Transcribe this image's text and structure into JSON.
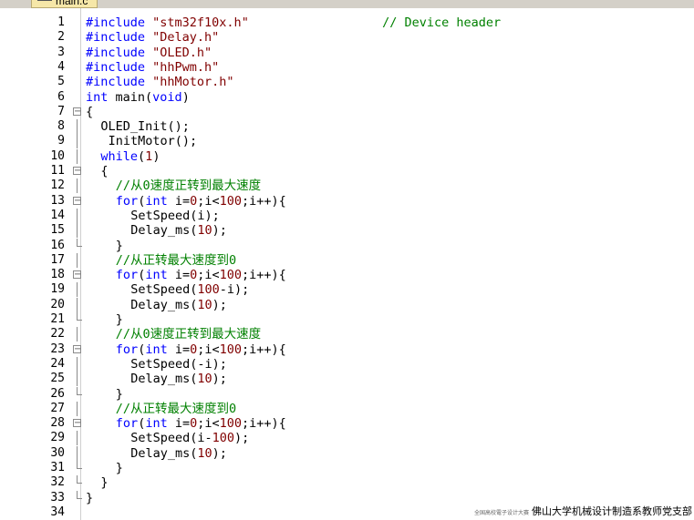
{
  "tab": {
    "title": "main.c"
  },
  "lines": [
    {
      "n": "1",
      "indent": 0,
      "fold": "",
      "tokens": [
        [
          "kw",
          "#include "
        ],
        [
          "str",
          "\"stm32f10x.h\""
        ],
        [
          "p",
          "                  "
        ],
        [
          "cm",
          "// Device header"
        ]
      ]
    },
    {
      "n": "2",
      "indent": 0,
      "fold": "",
      "tokens": [
        [
          "kw",
          "#include "
        ],
        [
          "str",
          "\"Delay.h\""
        ]
      ]
    },
    {
      "n": "3",
      "indent": 0,
      "fold": "",
      "tokens": [
        [
          "kw",
          "#include "
        ],
        [
          "str",
          "\"OLED.h\""
        ]
      ]
    },
    {
      "n": "4",
      "indent": 0,
      "fold": "",
      "tokens": [
        [
          "kw",
          "#include "
        ],
        [
          "str",
          "\"hhPwm.h\""
        ]
      ]
    },
    {
      "n": "5",
      "indent": 0,
      "fold": "",
      "tokens": [
        [
          "kw",
          "#include "
        ],
        [
          "str",
          "\"hhMotor.h\""
        ]
      ]
    },
    {
      "n": "6",
      "indent": 0,
      "fold": "",
      "tokens": [
        [
          "kw",
          "int"
        ],
        [
          "p",
          " main("
        ],
        [
          "kw",
          "void"
        ],
        [
          "p",
          ")"
        ]
      ]
    },
    {
      "n": "7",
      "indent": 0,
      "fold": "open",
      "tokens": [
        [
          "p",
          "{"
        ]
      ]
    },
    {
      "n": "8",
      "indent": 2,
      "fold": "line",
      "tokens": [
        [
          "p",
          "OLED_Init();"
        ]
      ]
    },
    {
      "n": "9",
      "indent": 3,
      "fold": "line",
      "tokens": [
        [
          "p",
          "InitMotor();"
        ]
      ]
    },
    {
      "n": "10",
      "indent": 2,
      "fold": "line",
      "tokens": [
        [
          "kw",
          "while"
        ],
        [
          "p",
          "("
        ],
        [
          "num",
          "1"
        ],
        [
          "p",
          ")"
        ]
      ]
    },
    {
      "n": "11",
      "indent": 2,
      "fold": "open",
      "tokens": [
        [
          "p",
          "{"
        ]
      ]
    },
    {
      "n": "12",
      "indent": 4,
      "fold": "line",
      "tokens": [
        [
          "cm",
          "//从0速度正转到最大速度"
        ]
      ]
    },
    {
      "n": "13",
      "indent": 4,
      "fold": "open",
      "tokens": [
        [
          "kw",
          "for"
        ],
        [
          "p",
          "("
        ],
        [
          "kw",
          "int"
        ],
        [
          "p",
          " i="
        ],
        [
          "num",
          "0"
        ],
        [
          "p",
          ";i<"
        ],
        [
          "num",
          "100"
        ],
        [
          "p",
          ";i++){"
        ]
      ]
    },
    {
      "n": "14",
      "indent": 6,
      "fold": "line",
      "tokens": [
        [
          "p",
          "SetSpeed(i);"
        ]
      ]
    },
    {
      "n": "15",
      "indent": 6,
      "fold": "line",
      "tokens": [
        [
          "p",
          "Delay_ms("
        ],
        [
          "num",
          "10"
        ],
        [
          "p",
          ");"
        ]
      ]
    },
    {
      "n": "16",
      "indent": 4,
      "fold": "end",
      "tokens": [
        [
          "p",
          "}"
        ]
      ]
    },
    {
      "n": "17",
      "indent": 4,
      "fold": "line",
      "tokens": [
        [
          "cm",
          "//从正转最大速度到0"
        ]
      ]
    },
    {
      "n": "18",
      "indent": 4,
      "fold": "open",
      "tokens": [
        [
          "kw",
          "for"
        ],
        [
          "p",
          "("
        ],
        [
          "kw",
          "int"
        ],
        [
          "p",
          " i="
        ],
        [
          "num",
          "0"
        ],
        [
          "p",
          ";i<"
        ],
        [
          "num",
          "100"
        ],
        [
          "p",
          ";i++){"
        ]
      ]
    },
    {
      "n": "19",
      "indent": 6,
      "fold": "line",
      "tokens": [
        [
          "p",
          "SetSpeed("
        ],
        [
          "num",
          "100"
        ],
        [
          "p",
          "-i);"
        ]
      ]
    },
    {
      "n": "20",
      "indent": 6,
      "fold": "line",
      "tokens": [
        [
          "p",
          "Delay_ms("
        ],
        [
          "num",
          "10"
        ],
        [
          "p",
          ");"
        ]
      ]
    },
    {
      "n": "21",
      "indent": 4,
      "fold": "end",
      "tokens": [
        [
          "p",
          "}"
        ]
      ]
    },
    {
      "n": "22",
      "indent": 4,
      "fold": "line",
      "tokens": [
        [
          "cm",
          "//从0速度正转到最大速度"
        ]
      ]
    },
    {
      "n": "23",
      "indent": 4,
      "fold": "open",
      "tokens": [
        [
          "kw",
          "for"
        ],
        [
          "p",
          "("
        ],
        [
          "kw",
          "int"
        ],
        [
          "p",
          " i="
        ],
        [
          "num",
          "0"
        ],
        [
          "p",
          ";i<"
        ],
        [
          "num",
          "100"
        ],
        [
          "p",
          ";i++){"
        ]
      ]
    },
    {
      "n": "24",
      "indent": 6,
      "fold": "line",
      "tokens": [
        [
          "p",
          "SetSpeed(-i);"
        ]
      ]
    },
    {
      "n": "25",
      "indent": 6,
      "fold": "line",
      "tokens": [
        [
          "p",
          "Delay_ms("
        ],
        [
          "num",
          "10"
        ],
        [
          "p",
          ");"
        ]
      ]
    },
    {
      "n": "26",
      "indent": 4,
      "fold": "end",
      "tokens": [
        [
          "p",
          "}"
        ]
      ]
    },
    {
      "n": "27",
      "indent": 4,
      "fold": "line",
      "tokens": [
        [
          "cm",
          "//从正转最大速度到0"
        ]
      ]
    },
    {
      "n": "28",
      "indent": 4,
      "fold": "open",
      "tokens": [
        [
          "kw",
          "for"
        ],
        [
          "p",
          "("
        ],
        [
          "kw",
          "int"
        ],
        [
          "p",
          " i="
        ],
        [
          "num",
          "0"
        ],
        [
          "p",
          ";i<"
        ],
        [
          "num",
          "100"
        ],
        [
          "p",
          ";i++){"
        ]
      ]
    },
    {
      "n": "29",
      "indent": 6,
      "fold": "line",
      "tokens": [
        [
          "p",
          "SetSpeed(i-"
        ],
        [
          "num",
          "100"
        ],
        [
          "p",
          ");"
        ]
      ]
    },
    {
      "n": "30",
      "indent": 6,
      "fold": "line",
      "tokens": [
        [
          "p",
          "Delay_ms("
        ],
        [
          "num",
          "10"
        ],
        [
          "p",
          ");"
        ]
      ]
    },
    {
      "n": "31",
      "indent": 4,
      "fold": "end",
      "tokens": [
        [
          "p",
          "}"
        ]
      ]
    },
    {
      "n": "32",
      "indent": 2,
      "fold": "end",
      "tokens": [
        [
          "p",
          "}"
        ]
      ]
    },
    {
      "n": "33",
      "indent": 0,
      "fold": "end",
      "tokens": [
        [
          "p",
          "}"
        ]
      ]
    },
    {
      "n": "34",
      "indent": 0,
      "fold": "",
      "tokens": []
    }
  ],
  "watermark": {
    "small": "全国高校電子设计大赛",
    "text": "佛山大学机械设计制造系教师党支部"
  },
  "colors": {
    "keyword": "#0000ff",
    "string": "#800000",
    "comment": "#008000",
    "number": "#800000"
  }
}
